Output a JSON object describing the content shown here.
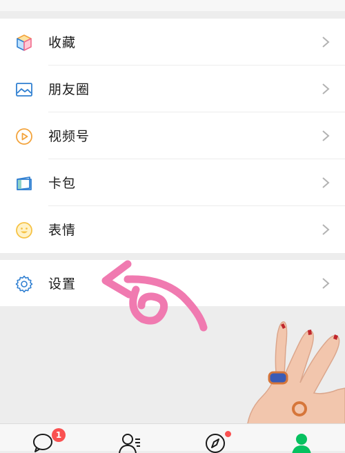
{
  "menu": {
    "items": [
      {
        "label": "收藏",
        "icon": "cube-icon"
      },
      {
        "label": "朋友圈",
        "icon": "photo-album-icon"
      },
      {
        "label": "视频号",
        "icon": "video-channel-icon"
      },
      {
        "label": "卡包",
        "icon": "card-wallet-icon"
      },
      {
        "label": "表情",
        "icon": "smiley-icon"
      }
    ],
    "settings": {
      "label": "设置",
      "icon": "gear-icon"
    }
  },
  "tabbar": {
    "tabs": [
      {
        "name": "chats",
        "icon": "chat-bubble-icon",
        "badge": "1"
      },
      {
        "name": "contacts",
        "icon": "contacts-icon"
      },
      {
        "name": "discover",
        "icon": "compass-icon",
        "has_dot": true
      },
      {
        "name": "me",
        "icon": "person-icon",
        "active": true
      }
    ]
  },
  "colors": {
    "background": "#ededed",
    "accent_green": "#07c160",
    "badge_red": "#fa5151",
    "icon_blue": "#2f7fd1",
    "icon_orange": "#f3a33b",
    "icon_yellow": "#f6c244"
  }
}
